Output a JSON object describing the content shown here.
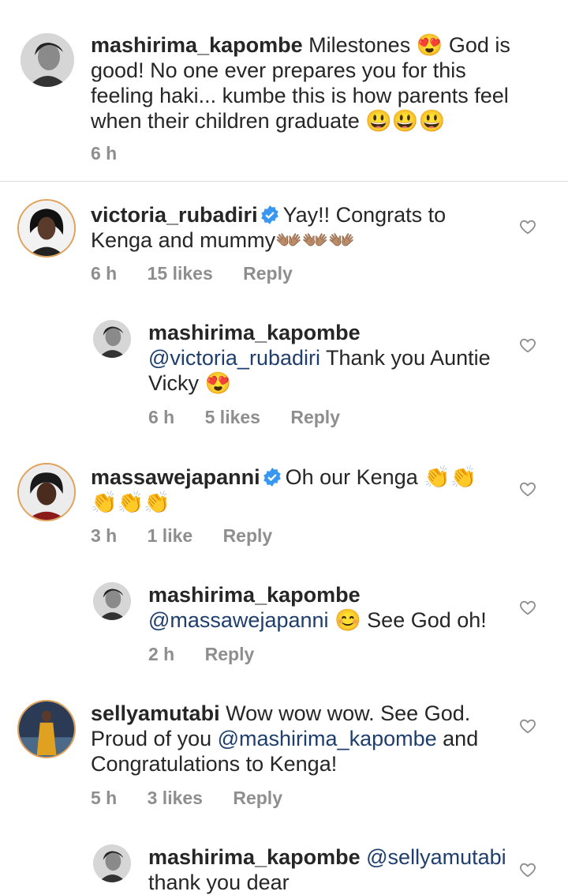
{
  "comments": [
    {
      "username": "mashirima_kapombe",
      "text": "Milestones 😍 God is good! No one ever prepares you for this feeling haki... kumbe this is how parents feel when their children graduate 😃😃😃",
      "time": "6 h"
    },
    {
      "username": "victoria_rubadiri",
      "verified": true,
      "text": "Yay!! Congrats to Kenga and mummy👐🏽👐🏽👐🏽",
      "time": "6 h",
      "likes": "15 likes",
      "reply_label": "Reply"
    },
    {
      "username": "mashirima_kapombe",
      "mention": "@victoria_rubadiri",
      "text": "Thank you Auntie Vicky 😍",
      "time": "6 h",
      "likes": "5 likes",
      "reply_label": "Reply"
    },
    {
      "username": "massawejapanni",
      "verified": true,
      "text": "Oh our Kenga 👏👏👏👏👏",
      "time": "3 h",
      "likes": "1 like",
      "reply_label": "Reply"
    },
    {
      "username": "mashirima_kapombe",
      "mention": "@massawejapanni",
      "text": "😊 See God oh!",
      "time": "2 h",
      "reply_label": "Reply"
    },
    {
      "username": "sellyamutabi",
      "text_before": "Wow wow wow. See God. Proud of you",
      "mention": "@mashirima_kapombe",
      "text_after": "and Congratulations to Kenga!",
      "time": "5 h",
      "likes": "3 likes",
      "reply_label": "Reply"
    },
    {
      "username": "mashirima_kapombe",
      "mention": "@sellyamutabi",
      "text": "thank you dear"
    }
  ],
  "icons": {
    "like": "heart-outline-icon",
    "verified": "verified-badge-icon"
  },
  "colors": {
    "meta": "#8e8e8e",
    "mention": "#1e3e6e",
    "verified": "#3897f0"
  }
}
